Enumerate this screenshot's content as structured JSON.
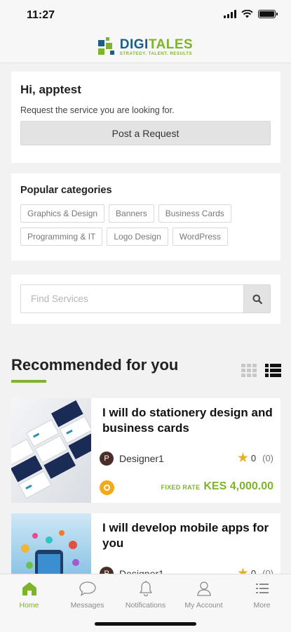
{
  "status_bar": {
    "time": "11:27"
  },
  "brand": {
    "name_part1": "DIGI",
    "name_part2": "TALES",
    "tagline": "STRATEGY. TALENT. RESULTS"
  },
  "greeting": {
    "title": "Hi, apptest",
    "subtitle": "Request the service you are looking for.",
    "button_label": "Post a Request"
  },
  "categories": {
    "title": "Popular categories",
    "items": [
      "Graphics & Design",
      "Banners",
      "Business Cards",
      "Programming & IT",
      "Logo Design",
      "WordPress"
    ]
  },
  "search": {
    "placeholder": "Find Services"
  },
  "recommended": {
    "title": "Recommended for you",
    "services": [
      {
        "title": "I will do stationery design and business cards",
        "seller_initial": "P",
        "seller": "Designer1",
        "rating": "0",
        "rating_count": "(0)",
        "rate_label": "FIXED RATE",
        "price": "KES 4,000.00"
      },
      {
        "title": "I will develop mobile apps for you",
        "seller_initial": "P",
        "seller": "Designer1",
        "rating": "0",
        "rating_count": "(0)"
      }
    ]
  },
  "tab_bar": {
    "items": [
      {
        "label": "Home",
        "icon": "home-icon",
        "active": true
      },
      {
        "label": "Messages",
        "icon": "chat-bubble-icon",
        "active": false
      },
      {
        "label": "Notifications",
        "icon": "bell-icon",
        "active": false
      },
      {
        "label": "My Account",
        "icon": "user-icon",
        "active": false
      },
      {
        "label": "More",
        "icon": "menu-list-icon",
        "active": false
      }
    ]
  },
  "colors": {
    "accent_green": "#7db428",
    "brand_blue": "#1c5e86",
    "star": "#e9b21b",
    "coin": "#f3a918"
  }
}
